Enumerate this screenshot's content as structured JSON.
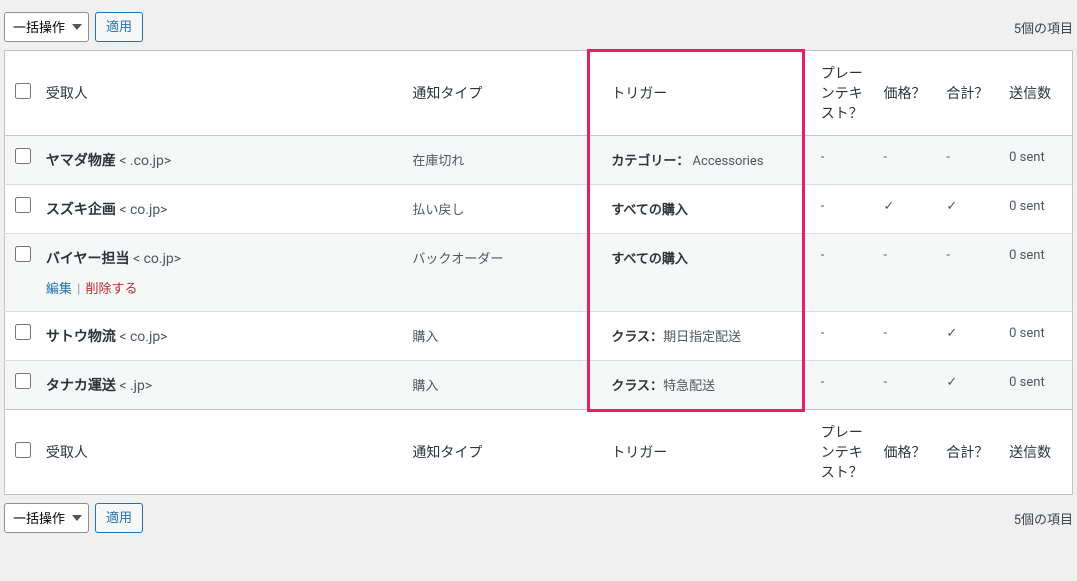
{
  "bulk_action_label": "一括操作",
  "apply_label": "適用",
  "item_count_text": "5個の項目",
  "columns": {
    "recipient": "受取人",
    "type": "通知タイプ",
    "trigger": "トリガー",
    "plain": "プレーンテキスト？",
    "price": "価格？",
    "total": "合計？",
    "sent": "送信数"
  },
  "row_actions": {
    "edit": "編集",
    "delete": "削除する"
  },
  "rows": [
    {
      "name": "ヤマダ物産",
      "email_open": " < ",
      "domain": ".co.jp>",
      "type": "在庫切れ",
      "trigger_label": "カテゴリー：",
      "trigger_value": " Accessories",
      "plain": "-",
      "price": "-",
      "total": "-",
      "sent": "0 sent"
    },
    {
      "name": "スズキ企画",
      "email_open": " < ",
      "domain": "co.jp>",
      "type": "払い戻し",
      "trigger_label": "すべての購入",
      "trigger_value": "",
      "plain": "-",
      "price": "✓",
      "total": "✓",
      "sent": "0 sent"
    },
    {
      "name": "バイヤー担当",
      "email_open": " < ",
      "domain": "co.jp>",
      "type": "バックオーダー",
      "trigger_label": "すべての購入",
      "trigger_value": "",
      "plain": "-",
      "price": "-",
      "total": "-",
      "sent": "0 sent",
      "show_actions": true
    },
    {
      "name": "サトウ物流",
      "email_open": " < ",
      "domain": "co.jp>",
      "type": "購入",
      "trigger_label": "クラス：",
      "trigger_value": "期日指定配送",
      "plain": "-",
      "price": "-",
      "total": "✓",
      "sent": "0 sent"
    },
    {
      "name": "タナカ運送",
      "email_open": " < ",
      "domain": ".jp>",
      "type": "購入",
      "trigger_label": "クラス：",
      "trigger_value": "特急配送",
      "plain": "-",
      "price": "-",
      "total": "✓",
      "sent": "0 sent"
    }
  ]
}
